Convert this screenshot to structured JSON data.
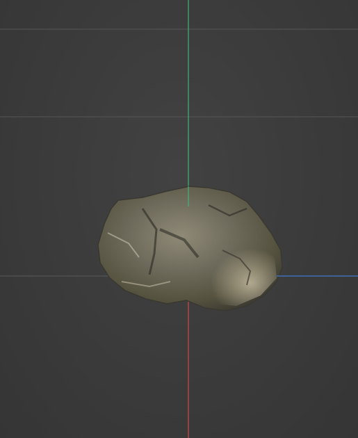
{
  "viewport": {
    "background_color": "#3b3b3b",
    "grid_color": "#5a5a5a",
    "axes": {
      "x_axis_color": "#3e7bd1",
      "y_axis_color": "#3fb37a",
      "z_axis_color": "#c94b4b"
    },
    "model": {
      "name": "rock-mesh",
      "base_color": "#6b6759",
      "highlight_color": "#b9b29c",
      "shadow_color": "#3a382f"
    }
  }
}
